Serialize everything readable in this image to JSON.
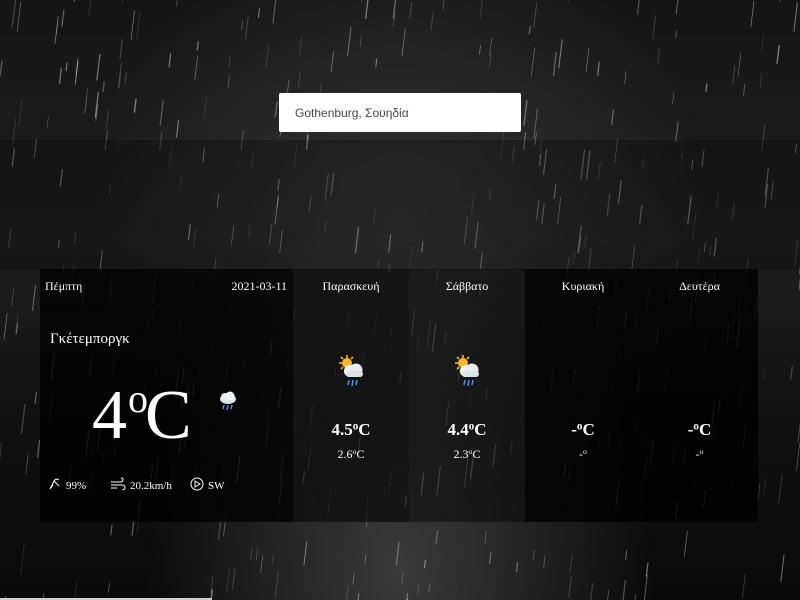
{
  "search": {
    "value": "Gothenburg, Σουηδία"
  },
  "today": {
    "day": "Πέμπτη",
    "date": "2021-03-11",
    "city": "Γκέτεμποργκ",
    "temp": "4",
    "temp_unit": "C",
    "degree": "o",
    "icon": "rain-cloud-icon",
    "humidity": "99%",
    "wind_speed": "20.2km/h",
    "wind_dir": "SW"
  },
  "forecast": [
    {
      "day": "Παρασκευή",
      "icon": "sun-cloud-rain-icon",
      "max": "4.5",
      "min": "2.6",
      "max_unit": "C",
      "min_unit": "C",
      "degree": "o"
    },
    {
      "day": "Σάββατο",
      "icon": "sun-cloud-rain-icon",
      "max": "4.4",
      "min": "2.3",
      "max_unit": "C",
      "min_unit": "C",
      "degree": "o"
    },
    {
      "day": "Κυριακή",
      "icon": "",
      "max": "-",
      "min": "-",
      "max_unit": "C",
      "min_unit": "",
      "degree": "o"
    },
    {
      "day": "Δευτέρα",
      "icon": "",
      "max": "-",
      "min": "-",
      "max_unit": "C",
      "min_unit": "",
      "degree": "o"
    }
  ],
  "colors": {
    "panel": "#000000",
    "text": "#ffffff",
    "search_bg": "#ffffff"
  }
}
